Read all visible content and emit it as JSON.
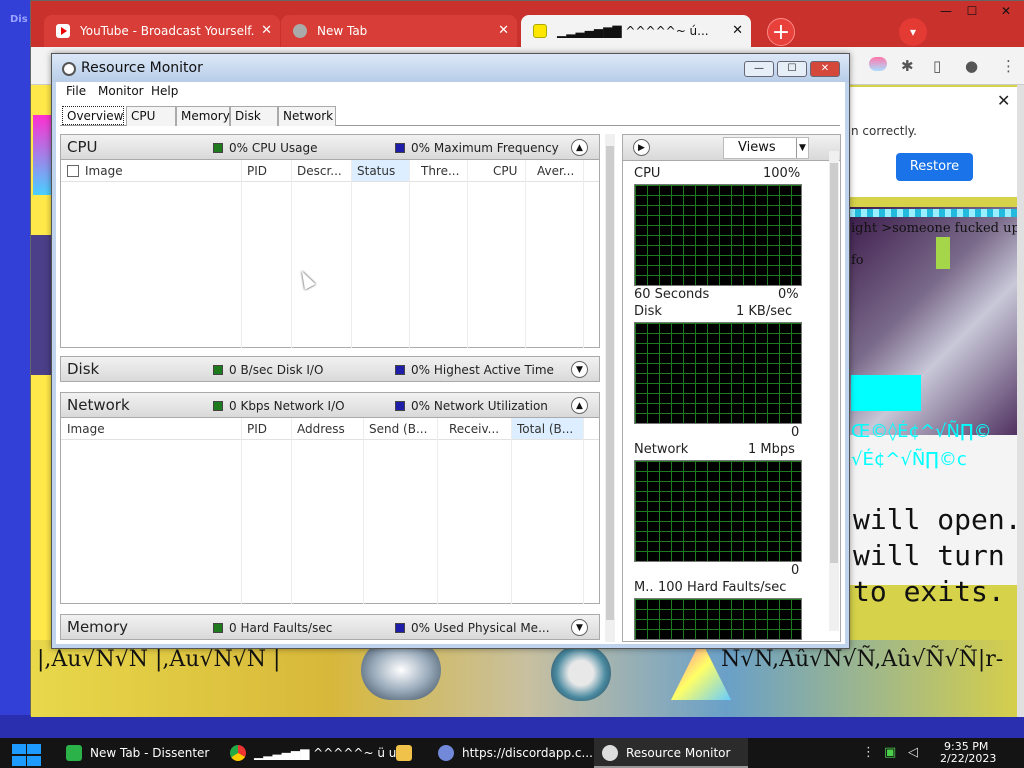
{
  "desktop": {
    "label": "Dis"
  },
  "browser": {
    "tabs": [
      {
        "title": "YouTube - Broadcast Yourself.",
        "close": "✕"
      },
      {
        "title": "New Tab",
        "close": "✕"
      },
      {
        "title": "▁▂▃▄▅▆▇ ^^^^^~ ú...",
        "close": "✕"
      }
    ],
    "new_tab": "+",
    "tab_search": "▾",
    "window_controls": {
      "minimize": "—",
      "maximize": "☐",
      "close": "✕"
    },
    "restore_banner": {
      "text": "n correctly.",
      "button": "Restore",
      "close": "✕"
    },
    "page_text": {
      "line1": "ight >someone fucked up",
      "line2": "fo",
      "big1": "will open.",
      "big2": "will turn",
      "big3": "to exits.",
      "garble1": "|,Au√Ñ√Ñ |,Au√Ñ√Ñ |",
      "garble2": "Ñ√Ñ,Aû√Ñ√Ñ,Aû√Ñ√Ñ|r-",
      "cyan1": "Œ©◊É¢^√Ñ∏©",
      "cyan2": "√É¢^√Ñ∏©c"
    }
  },
  "resmon": {
    "title": "Resource Monitor",
    "controls": {
      "minimize": "—",
      "maximize": "☐",
      "close": "✕"
    },
    "menu": [
      "File",
      "Monitor",
      "Help"
    ],
    "tabs": [
      "Overview",
      "CPU",
      "Memory",
      "Disk",
      "Network"
    ],
    "cpu": {
      "title": "CPU",
      "stat1": "0% CPU Usage",
      "stat2": "0% Maximum Frequency",
      "toggle": "▲",
      "columns": [
        "Image",
        "PID",
        "Descr...",
        "Status",
        "Thre...",
        "CPU",
        "Aver..."
      ]
    },
    "disk": {
      "title": "Disk",
      "stat1": "0 B/sec Disk I/O",
      "stat2": "0% Highest Active Time",
      "toggle": "▼"
    },
    "network": {
      "title": "Network",
      "stat1": "0 Kbps Network I/O",
      "stat2": "0% Network Utilization",
      "toggle": "▲",
      "columns": [
        "Image",
        "PID",
        "Address",
        "Send (B...",
        "Receiv...",
        "Total (B..."
      ]
    },
    "memory": {
      "title": "Memory",
      "stat1": "0 Hard Faults/sec",
      "stat2": "0% Used Physical Me...",
      "toggle": "▼"
    },
    "right_pane": {
      "expand": "▶",
      "views": "Views",
      "graphs": [
        {
          "name": "CPU",
          "max": "100%",
          "footer_left": "60 Seconds",
          "footer_right": "0%"
        },
        {
          "name": "Disk",
          "max": "1 KB/sec",
          "footer_right": "0"
        },
        {
          "name": "Network",
          "max": "1 Mbps",
          "footer_right": "0"
        },
        {
          "name": "M..",
          "max": "100 Hard Faults/sec"
        }
      ]
    }
  },
  "taskbar": {
    "items": [
      {
        "label": "New Tab - Dissenter"
      },
      {
        "label": "▁▂▃▄▅▆ ^^^^^~ ü u..."
      },
      {
        "label": ""
      },
      {
        "label": "https://discordapp.c..."
      },
      {
        "label": "Resource Monitor"
      }
    ],
    "time": "9:35 PM",
    "date": "2/22/2023"
  },
  "colors": {
    "accent_red": "#c9312d",
    "restore_blue": "#1a73e8",
    "graph_green": "#1e7a1e",
    "taskbar": "#141414"
  }
}
